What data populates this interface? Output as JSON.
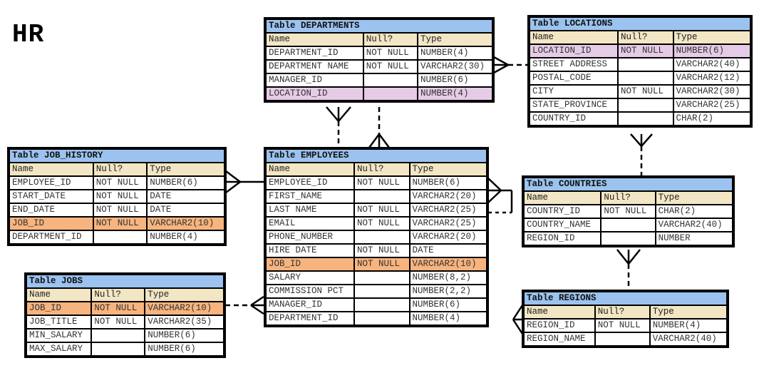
{
  "title": "HR",
  "column_headers": {
    "name": "Name",
    "null": "Null?",
    "type": "Type"
  },
  "colors": {
    "header": "#9cc3ef",
    "column_header": "#f2e6c4",
    "location_highlight": "#e6cbe6",
    "job_highlight": "#f8b47e"
  },
  "tables": {
    "departments": {
      "title": "Table DEPARTMENTS",
      "rows": [
        {
          "name": "DEPARTMENT_ID",
          "null": "NOT NULL",
          "type": "NUMBER(4)"
        },
        {
          "name": "DEPARTMENT NAME",
          "null": "NOT NULL",
          "type": "VARCHAR2(30)"
        },
        {
          "name": "MANAGER_ID",
          "null": "",
          "type": "NUMBER(6)"
        },
        {
          "name": "LOCATION_ID",
          "null": "",
          "type": "NUMBER(4)",
          "hl": "pk"
        }
      ]
    },
    "locations": {
      "title": "Table LOCATIONS",
      "rows": [
        {
          "name": "LOCATION_ID",
          "null": "NOT NULL",
          "type": "NUMBER(6)",
          "hl": "pk"
        },
        {
          "name": "STREET ADDRESS",
          "null": "",
          "type": "VARCHAR2(40)"
        },
        {
          "name": "POSTAL_CODE",
          "null": "",
          "type": "VARCHAR2(12)"
        },
        {
          "name": "CITY",
          "null": "NOT NULL",
          "type": "VARCHAR2(30)"
        },
        {
          "name": "STATE_PROVINCE",
          "null": "",
          "type": "VARCHAR2(25)"
        },
        {
          "name": "COUNTRY_ID",
          "null": "",
          "type": "CHAR(2)"
        }
      ]
    },
    "job_history": {
      "title": "Table JOB_HISTORY",
      "rows": [
        {
          "name": "EMPLOYEE_ID",
          "null": "NOT NULL",
          "type": "NUMBER(6)"
        },
        {
          "name": "START_DATE",
          "null": "NOT NULL",
          "type": "DATE"
        },
        {
          "name": "END_DATE",
          "null": "NOT NULL",
          "type": "DATE"
        },
        {
          "name": "JOB_ID",
          "null": "NOT NULL",
          "type": "VARCHAR2(10)",
          "hl": "job"
        },
        {
          "name": "DEPARTMENT_ID",
          "null": "",
          "type": "NUMBER(4)"
        }
      ]
    },
    "employees": {
      "title": "Table EMPLOYEES",
      "rows": [
        {
          "name": "EMPLOYEE_ID",
          "null": "NOT NULL",
          "type": "NUMBER(6)"
        },
        {
          "name": "FIRST_NAME",
          "null": "",
          "type": "VARCHAR2(20)"
        },
        {
          "name": "LAST NAME",
          "null": "NOT NULL",
          "type": "VARCHAR2(25)"
        },
        {
          "name": "EMAIL",
          "null": "NOT NULL",
          "type": "VARCHAR2(25)"
        },
        {
          "name": "PHONE_NUMBER",
          "null": "",
          "type": "VARCHAR2(20)"
        },
        {
          "name": "HIRE DATE",
          "null": "NOT NULL",
          "type": "DATE"
        },
        {
          "name": "JOB_ID",
          "null": "NOT NULL",
          "type": "VARCHAR2(10)",
          "hl": "job"
        },
        {
          "name": "SALARY",
          "null": "",
          "type": "NUMBER(8,2)"
        },
        {
          "name": "COMMISSION PCT",
          "null": "",
          "type": "NUMBER(2,2)"
        },
        {
          "name": "MANAGER_ID",
          "null": "",
          "type": "NUMBER(6)"
        },
        {
          "name": "DEPARTMENT_ID",
          "null": "",
          "type": "NUMBER(4)"
        }
      ]
    },
    "countries": {
      "title": "Table COUNTRIES",
      "rows": [
        {
          "name": "COUNTRY_ID",
          "null": "NOT NULL",
          "type": "CHAR(2)"
        },
        {
          "name": "COUNTRY_NAME",
          "null": "",
          "type": "VARCHAR2(40)"
        },
        {
          "name": "REGION_ID",
          "null": "",
          "type": "NUMBER"
        }
      ]
    },
    "jobs": {
      "title": "Table JOBS",
      "rows": [
        {
          "name": "JOB_ID",
          "null": "NOT NULL",
          "type": "VARCHAR2(10)",
          "hl": "job"
        },
        {
          "name": "JOB_TITLE",
          "null": "NOT NULL",
          "type": "VARCHAR2(35)"
        },
        {
          "name": "MIN_SALARY",
          "null": "",
          "type": "NUMBER(6)"
        },
        {
          "name": "MAX_SALARY",
          "null": "",
          "type": "NUMBER(6)"
        }
      ]
    },
    "regions": {
      "title": "Table REGIONS",
      "rows": [
        {
          "name": "REGION_ID",
          "null": "NOT NULL",
          "type": "NUMBER(4)"
        },
        {
          "name": "REGION_NAME",
          "null": "",
          "type": "VARCHAR2(40)"
        }
      ]
    }
  }
}
